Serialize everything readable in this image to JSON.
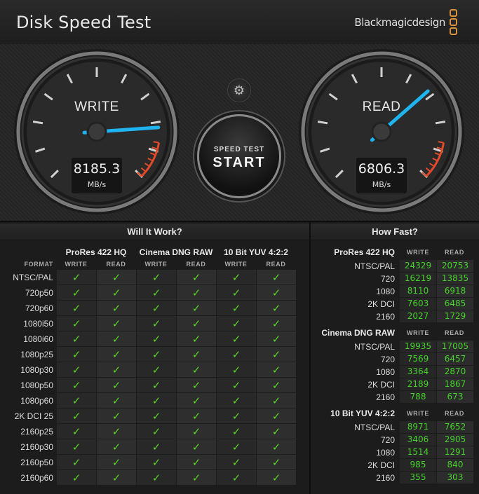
{
  "app": {
    "title": "Disk Speed Test",
    "brand": "Blackmagicdesign"
  },
  "gauges": {
    "write": {
      "label": "WRITE",
      "value": "8185.3",
      "unit": "MB/s"
    },
    "read": {
      "label": "READ",
      "value": "6806.3",
      "unit": "MB/s"
    }
  },
  "start": {
    "line1": "SPEED TEST",
    "line2": "START"
  },
  "will_it_work": {
    "title": "Will It Work?",
    "format_label": "FORMAT",
    "groups": [
      "ProRes 422 HQ",
      "Cinema DNG RAW",
      "10 Bit YUV 4:2:2"
    ],
    "subcols": [
      "WRITE",
      "READ"
    ],
    "formats": [
      "NTSC/PAL",
      "720p50",
      "720p60",
      "1080i50",
      "1080i60",
      "1080p25",
      "1080p30",
      "1080p50",
      "1080p60",
      "2K DCI 25",
      "2160p25",
      "2160p30",
      "2160p50",
      "2160p60"
    ]
  },
  "how_fast": {
    "title": "How Fast?",
    "colheads": [
      "WRITE",
      "READ"
    ],
    "groups": [
      {
        "name": "ProRes 422 HQ",
        "rows": [
          {
            "format": "NTSC/PAL",
            "write": "24329",
            "read": "20753"
          },
          {
            "format": "720",
            "write": "16219",
            "read": "13835"
          },
          {
            "format": "1080",
            "write": "8110",
            "read": "6918"
          },
          {
            "format": "2K DCI",
            "write": "7603",
            "read": "6485"
          },
          {
            "format": "2160",
            "write": "2027",
            "read": "1729"
          }
        ]
      },
      {
        "name": "Cinema DNG RAW",
        "rows": [
          {
            "format": "NTSC/PAL",
            "write": "19935",
            "read": "17005"
          },
          {
            "format": "720",
            "write": "7569",
            "read": "6457"
          },
          {
            "format": "1080",
            "write": "3364",
            "read": "2870"
          },
          {
            "format": "2K DCI",
            "write": "2189",
            "read": "1867"
          },
          {
            "format": "2160",
            "write": "788",
            "read": "673"
          }
        ]
      },
      {
        "name": "10 Bit YUV 4:2:2",
        "rows": [
          {
            "format": "NTSC/PAL",
            "write": "8971",
            "read": "7652"
          },
          {
            "format": "720",
            "write": "3406",
            "read": "2905"
          },
          {
            "format": "1080",
            "write": "1514",
            "read": "1291"
          },
          {
            "format": "2K DCI",
            "write": "985",
            "read": "840"
          },
          {
            "format": "2160",
            "write": "355",
            "read": "303"
          }
        ]
      }
    ]
  },
  "colors": {
    "needle": "#1fb3f0",
    "check": "#5ed22a",
    "value": "#46d02a",
    "brand": "#d8923a",
    "redline": "#e04a2a"
  }
}
